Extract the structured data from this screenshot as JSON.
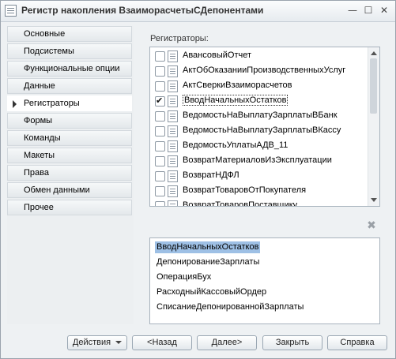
{
  "window": {
    "title": "Регистр накопления ВзаиморасчетыСДепонентами"
  },
  "nav": {
    "items": [
      "Основные",
      "Подсистемы",
      "Функциональные опции",
      "Данные",
      "Регистраторы",
      "Формы",
      "Команды",
      "Макеты",
      "Права",
      "Обмен данными",
      "Прочее"
    ],
    "active_index": 4
  },
  "registrators": {
    "label": "Регистраторы:",
    "items": [
      {
        "name": "АвансовыйОтчет",
        "checked": false
      },
      {
        "name": "АктОбОказанииПроизводственныхУслуг",
        "checked": false
      },
      {
        "name": "АктСверкиВзаиморасчетов",
        "checked": false
      },
      {
        "name": "ВводНачальныхОстатков",
        "checked": true
      },
      {
        "name": "ВедомостьНаВыплатуЗарплатыВБанк",
        "checked": false
      },
      {
        "name": "ВедомостьНаВыплатуЗарплатыВКассу",
        "checked": false
      },
      {
        "name": "ВедомостьУплатыАДВ_11",
        "checked": false
      },
      {
        "name": "ВозвратМатериаловИзЭксплуатации",
        "checked": false
      },
      {
        "name": "ВозвратНДФЛ",
        "checked": false
      },
      {
        "name": "ВозвратТоваровОтПокупателя",
        "checked": false
      },
      {
        "name": "ВозвратТоваровПоставщику",
        "checked": false
      }
    ]
  },
  "selected_list": {
    "items": [
      "ВводНачальныхОстатков",
      "ДепонированиеЗарплаты",
      "ОперацияБух",
      "РасходныйКассовыйОрдер",
      "СписаниеДепонированнойЗарплаты"
    ],
    "highlight_index": 0
  },
  "buttons": {
    "actions": "Действия",
    "back": "<Назад",
    "next": "Далее>",
    "close": "Закрыть",
    "help": "Справка"
  }
}
